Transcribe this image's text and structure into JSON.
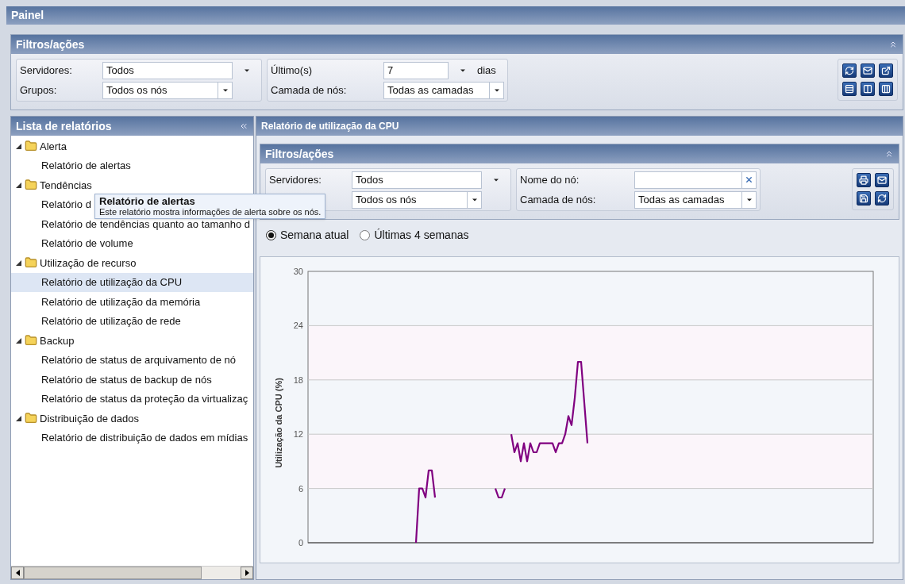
{
  "window": {
    "title": "Painel"
  },
  "top_filters": {
    "title": "Filtros/ações",
    "groups": [
      {
        "fields": [
          {
            "label": "Servidores:",
            "value": "Todos",
            "kind": "combo"
          },
          {
            "label": "Grupos:",
            "value": "Todos os nós",
            "kind": "select"
          }
        ]
      },
      {
        "fields": [
          {
            "label": "Último(s)",
            "value": "7",
            "kind": "combo",
            "suffix": "dias"
          },
          {
            "label": "Camada de nós:",
            "value": "Todas as camadas",
            "kind": "select"
          }
        ]
      }
    ],
    "actions": [
      {
        "kind": "refresh"
      },
      {
        "kind": "mail"
      },
      {
        "kind": "export"
      },
      {
        "kind": "rows"
      },
      {
        "kind": "columns2"
      },
      {
        "kind": "columns3"
      }
    ]
  },
  "report_list": {
    "title": "Lista de relatórios",
    "groups": [
      {
        "label": "Alerta",
        "expanded": true,
        "items": [
          {
            "label": "Relatório de alertas",
            "selected": false
          }
        ]
      },
      {
        "label": "Tendências",
        "expanded": true,
        "items": [
          {
            "label": "Relatório d",
            "selected": false
          },
          {
            "label": "Relatório de tendências quanto ao tamanho d",
            "selected": false
          },
          {
            "label": "Relatório de volume",
            "selected": false
          }
        ]
      },
      {
        "label": "Utilização de recurso",
        "expanded": true,
        "items": [
          {
            "label": "Relatório de utilização da CPU",
            "selected": true
          },
          {
            "label": "Relatório de utilização da memória",
            "selected": false
          },
          {
            "label": "Relatório de utilização de rede",
            "selected": false
          }
        ]
      },
      {
        "label": "Backup",
        "expanded": true,
        "items": [
          {
            "label": "Relatório de status de arquivamento de nó",
            "selected": false
          },
          {
            "label": "Relatório de status de backup de nós",
            "selected": false
          },
          {
            "label": "Relatório de status da proteção da virtualizaç",
            "selected": false
          }
        ]
      },
      {
        "label": "Distribuição de dados",
        "expanded": true,
        "items": [
          {
            "label": "Relatório de distribuição de dados em mídias",
            "selected": false
          }
        ]
      }
    ]
  },
  "tooltip": {
    "title": "Relatório de alertas",
    "text": "Este relatório mostra informações de alerta sobre os nós."
  },
  "report": {
    "title": "Relatório de utilização da CPU",
    "filters": {
      "title": "Filtros/ações",
      "groups": [
        {
          "fields": [
            {
              "label": "Servidores:",
              "value": "Todos",
              "kind": "combo"
            },
            {
              "value": "Todos os nós",
              "kind": "select"
            }
          ]
        },
        {
          "fields": [
            {
              "label": "Nome do nó:",
              "kind": "clearable"
            },
            {
              "label": "Camada de nós:",
              "value": "Todas as camadas",
              "kind": "select"
            }
          ]
        }
      ],
      "actions": [
        {
          "kind": "print"
        },
        {
          "kind": "mail"
        },
        {
          "kind": "save"
        },
        {
          "kind": "refresh"
        }
      ]
    },
    "periods": [
      {
        "label": "Semana atual",
        "selected": true
      },
      {
        "label": "Últimas 4 semanas",
        "selected": false
      }
    ],
    "chart_data": {
      "type": "line",
      "grid": true,
      "ylabel": "Utilização da CPU (%)",
      "ylim": [
        0,
        30
      ],
      "yticks": [
        0,
        6,
        12,
        18,
        24,
        30
      ],
      "categories": [
        null,
        null,
        null,
        null,
        null,
        null,
        null,
        null,
        null,
        null,
        null,
        null,
        null,
        null,
        null,
        null,
        null,
        null,
        null,
        null,
        null,
        null,
        null,
        null,
        null,
        null,
        null,
        null,
        null,
        null,
        null,
        null,
        null,
        null,
        null,
        null,
        null,
        null,
        null,
        null,
        null,
        null,
        null,
        null,
        null,
        null,
        null,
        null,
        null,
        null,
        null,
        null,
        null,
        null,
        null,
        null,
        null,
        null,
        null,
        null,
        null,
        null,
        null,
        null,
        null,
        null,
        null,
        null,
        null,
        null,
        null,
        null,
        null,
        null,
        null,
        null,
        null,
        null,
        null,
        null,
        null,
        null,
        null,
        null,
        null,
        null,
        null,
        null,
        null,
        null,
        null,
        null,
        null,
        null,
        null,
        null,
        null,
        null,
        null,
        null,
        null,
        null,
        null,
        null,
        null,
        null,
        null,
        null,
        null,
        null,
        null,
        null,
        null,
        null,
        null,
        null,
        null,
        null,
        null,
        null,
        null,
        null,
        null,
        null,
        null,
        null,
        null,
        null,
        null,
        null,
        null,
        null,
        null,
        null,
        null,
        null,
        null,
        null,
        null,
        null,
        null,
        null,
        null,
        null,
        null,
        null,
        null,
        null,
        null,
        null,
        null,
        null,
        null,
        null,
        null,
        null,
        null,
        null,
        null,
        null,
        null,
        null,
        null,
        null,
        null,
        null,
        null,
        null,
        null,
        null,
        null,
        null,
        null,
        null,
        null,
        null,
        null,
        null,
        null
      ],
      "series": [
        {
          "color": "#800080",
          "values": [
            null,
            null,
            null,
            null,
            null,
            null,
            null,
            null,
            null,
            null,
            null,
            null,
            null,
            null,
            null,
            null,
            null,
            null,
            null,
            null,
            null,
            null,
            null,
            null,
            null,
            null,
            null,
            null,
            null,
            null,
            null,
            null,
            null,
            null,
            0,
            6,
            6,
            5,
            8,
            8,
            5,
            null,
            null,
            null,
            null,
            null,
            null,
            null,
            null,
            null,
            null,
            null,
            null,
            null,
            null,
            null,
            null,
            null,
            null,
            6,
            5,
            5,
            6,
            null,
            12,
            10,
            11,
            9,
            11,
            9,
            11,
            10,
            10,
            11,
            11,
            11,
            11,
            11,
            10,
            11,
            11,
            12,
            14,
            13,
            16,
            20,
            20,
            15.5,
            11,
            null,
            null,
            null,
            null,
            null,
            null,
            null,
            null,
            null,
            null,
            null,
            null,
            null,
            null,
            null,
            null,
            null,
            null,
            null,
            null,
            null,
            null,
            null,
            null,
            null,
            null,
            null,
            null,
            null,
            null,
            null,
            null,
            null,
            null,
            null,
            null,
            null,
            null,
            null,
            null,
            null,
            null,
            null,
            null,
            null,
            null,
            null,
            null,
            null,
            null,
            null,
            null,
            null,
            null,
            null,
            null,
            null,
            null,
            null,
            null,
            null,
            null,
            null,
            null,
            null,
            null,
            null,
            null,
            null,
            null,
            null,
            null,
            null,
            null,
            null,
            null,
            null,
            null,
            null,
            null,
            null,
            null,
            null,
            null,
            null,
            null,
            null,
            null,
            null,
            null
          ]
        }
      ]
    }
  }
}
